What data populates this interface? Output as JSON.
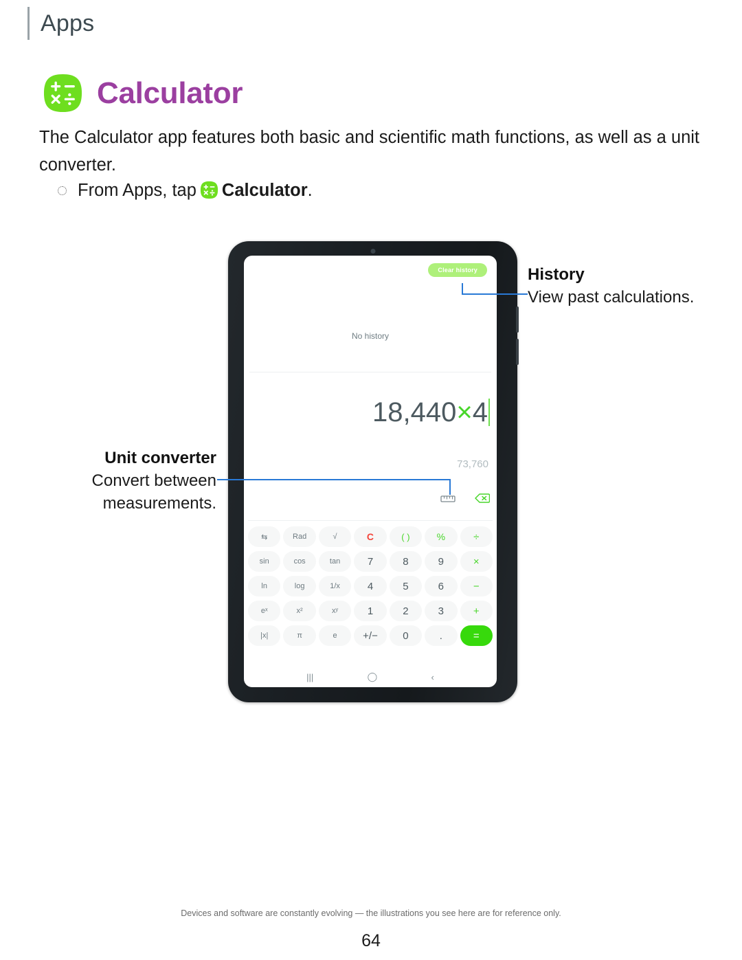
{
  "header": {
    "section_label": "Apps"
  },
  "app": {
    "title": "Calculator",
    "icon_name": "calculator-app-icon",
    "icon_bg": "#6ede1f",
    "title_color": "#9b3fa0"
  },
  "intro": "The Calculator app features both basic and scientific math functions, as well as a unit converter.",
  "bullet": {
    "prefix": "From Apps, tap",
    "app_name": "Calculator",
    "suffix": "."
  },
  "device": {
    "name": "galaxy-tab-illustration",
    "screen": {
      "history": {
        "clear_button": "Clear history",
        "empty_text": "No history"
      },
      "display": {
        "expression_operand_1": "18,440",
        "expression_operator": "×",
        "expression_operand_2": "4",
        "result": "73,760"
      },
      "tools": [
        {
          "name": "unit-converter-icon",
          "label": "ruler"
        },
        {
          "name": "backspace-icon",
          "label": "backspace"
        }
      ],
      "keypad": [
        {
          "label": "⇆",
          "name": "key-swap",
          "style": "fn"
        },
        {
          "label": "Rad",
          "name": "key-rad",
          "style": "fn"
        },
        {
          "label": "√",
          "name": "key-sqrt",
          "style": "fn"
        },
        {
          "label": "C",
          "name": "key-clear",
          "style": "clear"
        },
        {
          "label": "( )",
          "name": "key-parentheses",
          "style": "paren"
        },
        {
          "label": "%",
          "name": "key-percent",
          "style": "pct"
        },
        {
          "label": "÷",
          "name": "key-divide",
          "style": "op"
        },
        {
          "label": "sin",
          "name": "key-sin",
          "style": "fn"
        },
        {
          "label": "cos",
          "name": "key-cos",
          "style": "fn"
        },
        {
          "label": "tan",
          "name": "key-tan",
          "style": "fn"
        },
        {
          "label": "7",
          "name": "key-7",
          "style": "num"
        },
        {
          "label": "8",
          "name": "key-8",
          "style": "num"
        },
        {
          "label": "9",
          "name": "key-9",
          "style": "num"
        },
        {
          "label": "×",
          "name": "key-multiply",
          "style": "op"
        },
        {
          "label": "ln",
          "name": "key-ln",
          "style": "fn"
        },
        {
          "label": "log",
          "name": "key-log",
          "style": "fn"
        },
        {
          "label": "1/x",
          "name": "key-reciprocal",
          "style": "fn"
        },
        {
          "label": "4",
          "name": "key-4",
          "style": "num"
        },
        {
          "label": "5",
          "name": "key-5",
          "style": "num"
        },
        {
          "label": "6",
          "name": "key-6",
          "style": "num"
        },
        {
          "label": "−",
          "name": "key-minus",
          "style": "op"
        },
        {
          "label": "eˣ",
          "name": "key-exp",
          "style": "fn"
        },
        {
          "label": "x²",
          "name": "key-square",
          "style": "fn"
        },
        {
          "label": "xʸ",
          "name": "key-power",
          "style": "fn"
        },
        {
          "label": "1",
          "name": "key-1",
          "style": "num"
        },
        {
          "label": "2",
          "name": "key-2",
          "style": "num"
        },
        {
          "label": "3",
          "name": "key-3",
          "style": "num"
        },
        {
          "label": "+",
          "name": "key-plus",
          "style": "op"
        },
        {
          "label": "|x|",
          "name": "key-abs",
          "style": "fn"
        },
        {
          "label": "π",
          "name": "key-pi",
          "style": "fn"
        },
        {
          "label": "e",
          "name": "key-e",
          "style": "fn"
        },
        {
          "label": "+/−",
          "name": "key-sign",
          "style": "num"
        },
        {
          "label": "0",
          "name": "key-0",
          "style": "num"
        },
        {
          "label": ".",
          "name": "key-decimal",
          "style": "num"
        },
        {
          "label": "=",
          "name": "key-equals",
          "style": "equals"
        }
      ],
      "navbar": [
        {
          "glyph": "|||",
          "name": "nav-recents-icon"
        },
        {
          "glyph": "◯",
          "name": "nav-home-icon"
        },
        {
          "glyph": "‹",
          "name": "nav-back-icon"
        }
      ]
    }
  },
  "callouts": [
    {
      "title": "History",
      "description": "View past calculations."
    },
    {
      "title": "Unit converter",
      "description": "Convert between measurements."
    }
  ],
  "footer": {
    "note": "Devices and software are constantly evolving — the illustrations you see here are for reference only.",
    "page_number": "64"
  },
  "colors": {
    "leader_line": "#2979d6",
    "accent_green": "#37d90c",
    "brand_purple": "#9b3fa0"
  }
}
